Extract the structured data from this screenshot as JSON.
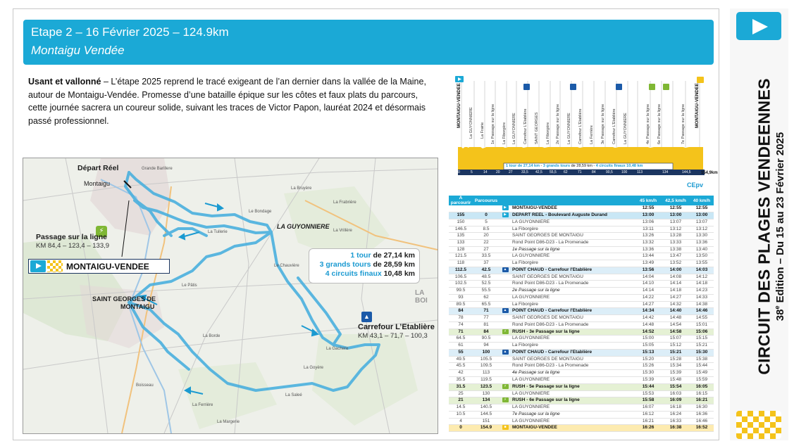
{
  "header": {
    "title": "Etape 2 – 16 Février 2025 – 124.9km",
    "subtitle": "Montaigu Vendée"
  },
  "intro": {
    "lead": "Usant et vallonné",
    "text": " – L’étape 2025 reprend le tracé exigeant de l’an dernier dans la vallée de la Maine, autour de Montaigu-Vendée. Promesse d’une bataille épique sur les côtes et faux plats du parcours, cette journée sacrera un coureur solide, suivant les traces de Victor Papon, lauréat 2024 et désormais passé professionnel."
  },
  "map": {
    "depart_label": "Départ Réel",
    "town_montaigu": "Montaigu",
    "town_guyonniere": "LA GUYONNIERE",
    "town_saint_georges_1": "SAINT GEORGES DE",
    "town_saint_georges_2": "MONTAIGU",
    "town_boisee": "LA BOI",
    "passage_title": "Passage sur la ligne",
    "passage_km": "KM 84,4 – 123,4 – 133,9",
    "start_finish": "MONTAIGU-VENDEE",
    "info_line1_num": "1 tour",
    "info_line1_rest": " de 27,14 km",
    "info_line2_num": "3 grands tours",
    "info_line2_rest": " de 28,59 km",
    "info_line3_num": "4 circuits finaux",
    "info_line3_rest": " 10,48 km",
    "kom_title": "Carrefour L’Etablière",
    "kom_km": "KM 43,1 – 71,7 – 100,3",
    "places": [
      "Grande Barillere",
      "Le Bondage",
      "Le Chauvière",
      "La Bruyère",
      "La Frabrière",
      "La Vrillère",
      "Le Pâtis",
      "La Tuilerie",
      "La Borde",
      "La Gachere",
      "La Goyère",
      "La Saleé",
      "La Ferrière",
      "Boisseau",
      "La Margerie"
    ]
  },
  "profile": {
    "labels": [
      "MONTAIGU-VENDEE",
      "La GUYONNIERE",
      "La Frairie",
      "1e Passage sur la ligne",
      "La Fiborgère",
      "La GUYONNIERE",
      "Carrefour L'Etablière",
      "SAINT GEORGES",
      "La Fiborgère",
      "2e Passage sur la ligne",
      "La GUYONNIERE",
      "Carrefour L'Etablière",
      "La Ferrière",
      "3e Passage sur la ligne",
      "Carrefour L'Etablière",
      "La GUYONNIERE",
      "4e Passage sur la ligne",
      "6e Passage sur la ligne",
      "7e Passage sur la ligne",
      "MONTAIGU-VENDEE"
    ],
    "km_ticks": [
      "0",
      "5",
      "14",
      "20",
      "27",
      "33,5",
      "42,5",
      "55,5",
      "62",
      "71",
      "84",
      "90,5",
      "100",
      "113",
      "134",
      "144,5"
    ],
    "end_label": "154,9km",
    "legend_a": "1 tour de 27,14 km",
    "legend_b": "3 grands tours",
    "legend_c": " de 28,59 km",
    "legend_d": "4 circuits finaux 10,48 km"
  },
  "table": {
    "logo": "CEpv",
    "headers": [
      "A parcourir",
      "Parcourus",
      "",
      "",
      "45 km/h",
      "42,5 km/h",
      "40 km/h"
    ],
    "rows": [
      {
        "a": "",
        "p": "",
        "icon": "cyan",
        "place": "MONTAIGU-VENDEE",
        "t1": "12:55",
        "t2": "12:55",
        "t3": "12:55",
        "kind": "hl"
      },
      {
        "a": "155",
        "p": "0",
        "icon": "cyan",
        "place": "DEPART REEL - Boulevard Auguste Durand",
        "t1": "13:00",
        "t2": "13:00",
        "t3": "13:00",
        "kind": "dep"
      },
      {
        "a": "150",
        "p": "5",
        "icon": "",
        "place": "LA GUYONNIERE",
        "t1": "13:06",
        "t2": "13:07",
        "t3": "13:07",
        "kind": ""
      },
      {
        "a": "146.5",
        "p": "8.5",
        "icon": "",
        "place": "La Fiborgère",
        "t1": "13:11",
        "t2": "13:12",
        "t3": "13:12",
        "kind": ""
      },
      {
        "a": "135",
        "p": "20",
        "icon": "",
        "place": "SAINT GEORGES DE MONTAIGU",
        "t1": "13:26",
        "t2": "13:28",
        "t3": "13:30",
        "kind": ""
      },
      {
        "a": "133",
        "p": "22",
        "icon": "",
        "place": "Rond Point D86-D23 - La Promenade",
        "t1": "13:32",
        "t2": "13:33",
        "t3": "13:36",
        "kind": ""
      },
      {
        "a": "128",
        "p": "27",
        "icon": "",
        "place": "1e Passage sur la ligne",
        "t1": "13:36",
        "t2": "13:38",
        "t3": "13:40",
        "kind": "it"
      },
      {
        "a": "121.5",
        "p": "33.5",
        "icon": "",
        "place": "LA GUYONNIERE",
        "t1": "13:44",
        "t2": "13:47",
        "t3": "13:50",
        "kind": ""
      },
      {
        "a": "118",
        "p": "37",
        "icon": "",
        "place": "La Fiborgère",
        "t1": "13:49",
        "t2": "13:52",
        "t3": "13:55",
        "kind": ""
      },
      {
        "a": "112.5",
        "p": "42.5",
        "icon": "navy",
        "place": "POINT CHAUD - Carrefour l'Etablière",
        "t1": "13:56",
        "t2": "14:00",
        "t3": "14:03",
        "kind": "kom"
      },
      {
        "a": "106.5",
        "p": "48.5",
        "icon": "",
        "place": "SAINT GEORGES DE MONTAIGU",
        "t1": "14:04",
        "t2": "14:08",
        "t3": "14:12",
        "kind": ""
      },
      {
        "a": "102.5",
        "p": "52.5",
        "icon": "",
        "place": "Rond Point D86-D23 - La Promenade",
        "t1": "14:10",
        "t2": "14:14",
        "t3": "14:18",
        "kind": ""
      },
      {
        "a": "99.5",
        "p": "55.5",
        "icon": "",
        "place": "2e Passage sur la ligne",
        "t1": "14:14",
        "t2": "14:18",
        "t3": "14:23",
        "kind": "it"
      },
      {
        "a": "93",
        "p": "62",
        "icon": "",
        "place": "LA GUYONNIERE",
        "t1": "14:22",
        "t2": "14:27",
        "t3": "14:33",
        "kind": ""
      },
      {
        "a": "89.5",
        "p": "65.5",
        "icon": "",
        "place": "La Fiborgère",
        "t1": "14:27",
        "t2": "14:32",
        "t3": "14:38",
        "kind": ""
      },
      {
        "a": "84",
        "p": "71",
        "icon": "navy",
        "place": "POINT CHAUD - Carrefour l'Etablière",
        "t1": "14:34",
        "t2": "14:40",
        "t3": "14:46",
        "kind": "kom"
      },
      {
        "a": "78",
        "p": "77",
        "icon": "",
        "place": "SAINT GEORGES DE MONTAIGU",
        "t1": "14:42",
        "t2": "14:48",
        "t3": "14:55",
        "kind": ""
      },
      {
        "a": "74",
        "p": "81",
        "icon": "",
        "place": "Rond Point D86-D23 - La Promenade",
        "t1": "14:48",
        "t2": "14:54",
        "t3": "15:01",
        "kind": ""
      },
      {
        "a": "71",
        "p": "84",
        "icon": "green",
        "place": "RUSH - 3e Passage sur la ligne",
        "t1": "14:52",
        "t2": "14:58",
        "t3": "15:06",
        "kind": "spr"
      },
      {
        "a": "64.5",
        "p": "90.5",
        "icon": "",
        "place": "LA GUYONNIERE",
        "t1": "15:00",
        "t2": "15:07",
        "t3": "15:15",
        "kind": ""
      },
      {
        "a": "61",
        "p": "94",
        "icon": "",
        "place": "La Fiborgère",
        "t1": "15:05",
        "t2": "15:12",
        "t3": "15:21",
        "kind": ""
      },
      {
        "a": "55",
        "p": "100",
        "icon": "navy",
        "place": "POINT CHAUD - Carrefour l'Etablière",
        "t1": "15:13",
        "t2": "15:21",
        "t3": "15:30",
        "kind": "kom"
      },
      {
        "a": "49.5",
        "p": "105.5",
        "icon": "",
        "place": "SAINT GEORGES DE MONTAIGU",
        "t1": "15:20",
        "t2": "15:28",
        "t3": "15:38",
        "kind": ""
      },
      {
        "a": "45.5",
        "p": "109.5",
        "icon": "",
        "place": "Rond Point D86-D23 - La Promenade",
        "t1": "15:26",
        "t2": "15:34",
        "t3": "15:44",
        "kind": ""
      },
      {
        "a": "42",
        "p": "113",
        "icon": "",
        "place": "4e Passage sur la ligne",
        "t1": "15:30",
        "t2": "15:39",
        "t3": "15:49",
        "kind": "it"
      },
      {
        "a": "35.5",
        "p": "119.5",
        "icon": "",
        "place": "LA GUYONNIERE",
        "t1": "15:39",
        "t2": "15:48",
        "t3": "15:59",
        "kind": ""
      },
      {
        "a": "31.5",
        "p": "123.5",
        "icon": "green",
        "place": "RUSH - 5e Passage sur la ligne",
        "t1": "15:44",
        "t2": "15:54",
        "t3": "16:05",
        "kind": "spr"
      },
      {
        "a": "25",
        "p": "130",
        "icon": "",
        "place": "LA GUYONNIERE",
        "t1": "15:53",
        "t2": "16:03",
        "t3": "16:15",
        "kind": ""
      },
      {
        "a": "21",
        "p": "134",
        "icon": "green",
        "place": "RUSH - 6e Passage sur la ligne",
        "t1": "15:58",
        "t2": "16:09",
        "t3": "16:21",
        "kind": "spr"
      },
      {
        "a": "14.5",
        "p": "140.5",
        "icon": "",
        "place": "LA GUYONNIERE",
        "t1": "16:07",
        "t2": "16:18",
        "t3": "16:30",
        "kind": ""
      },
      {
        "a": "10.5",
        "p": "144.5",
        "icon": "",
        "place": "7e Passage sur la ligne",
        "t1": "16:12",
        "t2": "16:24",
        "t3": "16:36",
        "kind": "it"
      },
      {
        "a": "4",
        "p": "151",
        "icon": "",
        "place": "LA GUYONNIERE",
        "t1": "16:21",
        "t2": "16:33",
        "t3": "16:46",
        "kind": ""
      },
      {
        "a": "0",
        "p": "154.9",
        "icon": "yel",
        "place": "MONTAIGU-VENDEE",
        "t1": "16:26",
        "t2": "16:38",
        "t3": "16:52",
        "kind": "fin"
      }
    ]
  },
  "sidebar": {
    "title": "CIRCUIT DES PLAGES VENDEENNES",
    "subtitle_a": "38",
    "subtitle_sup": "e",
    "subtitle_b": " Edition – Du 15 au 23 Février 2025"
  },
  "colors": {
    "accent": "#1ba9d6",
    "navy": "#1b5aa8",
    "sprint": "#7fb734",
    "finish": "#f4c31b",
    "route": "#3aa6d8"
  }
}
